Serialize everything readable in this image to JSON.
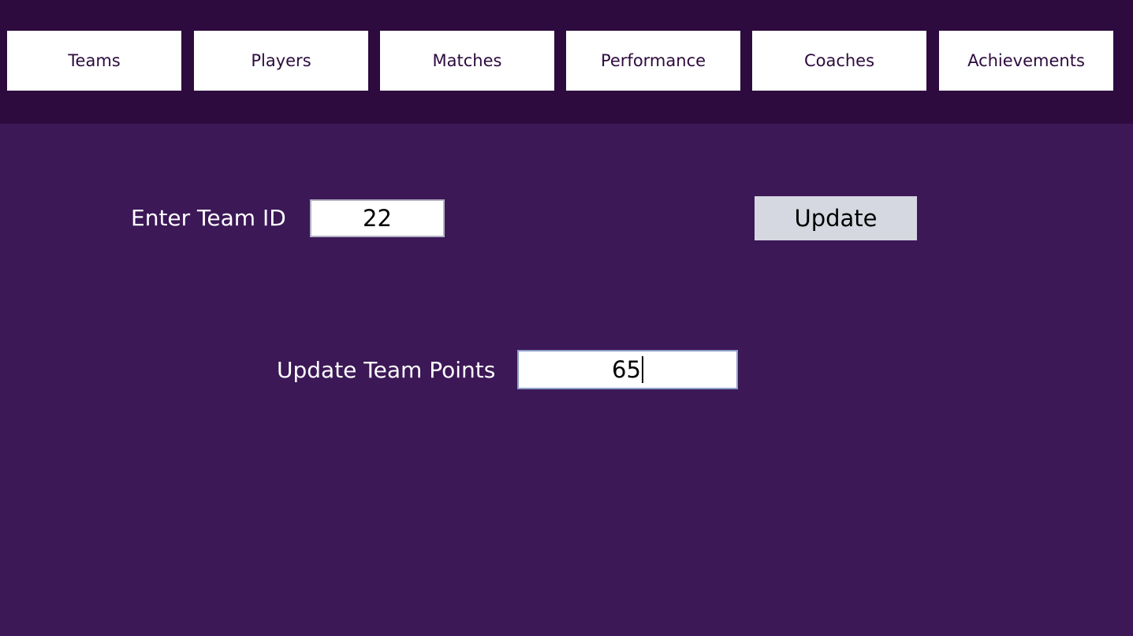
{
  "nav": {
    "items": [
      {
        "label": "Teams"
      },
      {
        "label": "Players"
      },
      {
        "label": "Matches"
      },
      {
        "label": "Performance"
      },
      {
        "label": "Coaches"
      },
      {
        "label": "Achievements"
      }
    ]
  },
  "form": {
    "team_id_label": "Enter Team ID",
    "team_id_value": "22",
    "points_label": "Update Team Points",
    "points_value": "65",
    "update_label": "Update"
  },
  "colors": {
    "header_bg": "#2d0b3e",
    "page_bg": "#3c1857",
    "nav_button_bg": "#ffffff",
    "update_button_bg": "#d5d8e0"
  }
}
